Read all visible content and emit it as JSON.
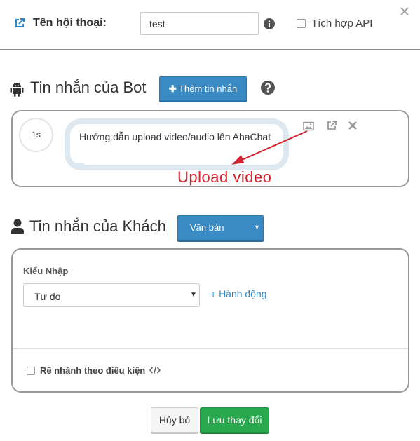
{
  "header": {
    "title": "Tên hội thoại:",
    "name_value": "test",
    "api_label": "Tích hợp API",
    "api_checked": false
  },
  "bot_section": {
    "title": "Tin nhắn của Bot",
    "add_button_label": "Thêm tin nhắn",
    "message": {
      "delay": "1s",
      "text": "Hướng dẫn upload video/audio lên AhaChat"
    },
    "annotation": "Upload video"
  },
  "guest_section": {
    "title": "Tin nhắn của Khách",
    "type_dropdown": "Văn bản",
    "input_type_label": "Kiểu Nhập",
    "input_type_value": "Tự do",
    "action_link": "+ Hành động",
    "branch_label": "Rẽ nhánh theo điều kiện",
    "branch_checked": false
  },
  "footer": {
    "cancel_label": "Hủy bỏ",
    "save_label": "Lưu thay đổi"
  },
  "colors": {
    "primary_blue": "#3a8bc4",
    "save_green": "#2aa84e",
    "annotation_red": "#d4232f",
    "link_blue": "#2f86c4"
  }
}
